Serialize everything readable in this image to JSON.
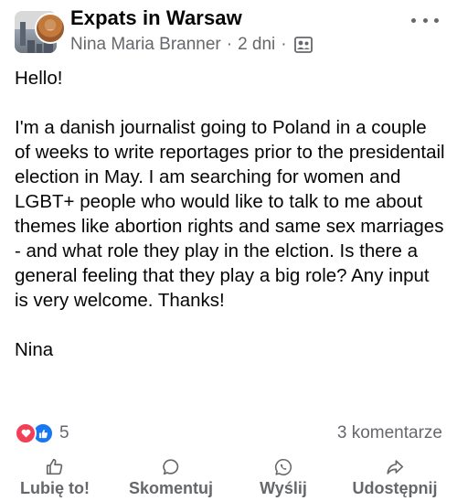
{
  "post": {
    "group_name": "Expats in Warsaw",
    "author": "Nina Maria Branner",
    "separator": "·",
    "time": "2 dni",
    "audience_icon": "group-members-icon",
    "more_icon": "more-dots-icon",
    "body": {
      "greeting": "Hello!",
      "paragraph": "I'm a danish journalist going to Poland in a couple of weeks to write reportages prior to the presidentail election in May. I am searching for women and LGBT+ people who would like to talk to me about themes like abortion rights and same sex marriages - and what role they play in the elction. Is there a general feeling that they play a big role? Any input is very welcome. Thanks!",
      "signature": "Nina"
    }
  },
  "stats": {
    "reaction_icons": [
      "love-reaction-icon",
      "like-reaction-icon"
    ],
    "reaction_count": "5",
    "comments": "3 komentarze"
  },
  "actions": {
    "like": "Lubię to!",
    "comment": "Skomentuj",
    "send": "Wyślij",
    "share": "Udostępnij"
  },
  "colors": {
    "secondary_text": "#65676b",
    "love": "#f33e58",
    "like": "#1877f2"
  }
}
